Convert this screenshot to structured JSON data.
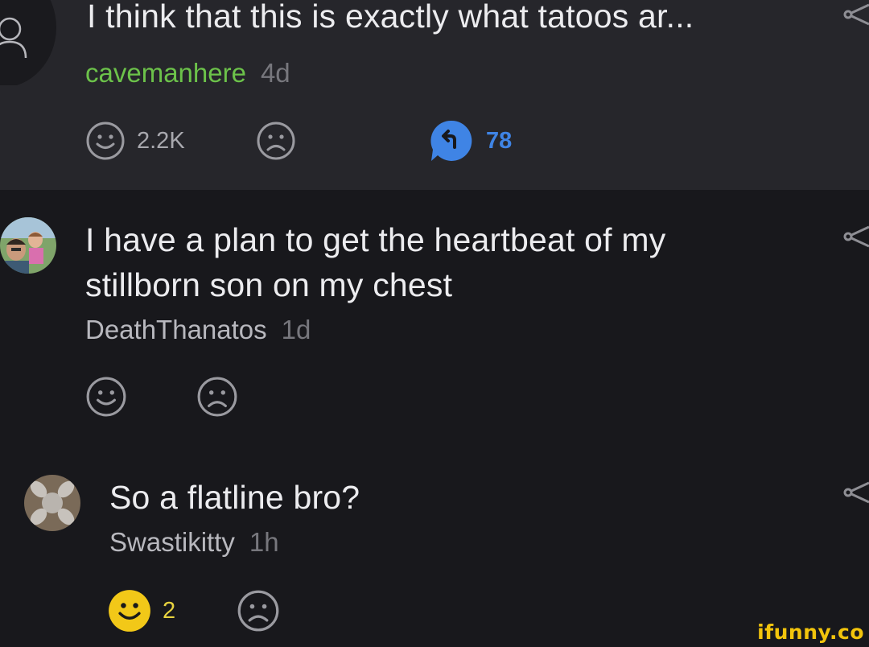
{
  "comments": [
    {
      "text": "I think that this is exactly what tatoos ar...",
      "author": "cavemanhere",
      "time": "4d",
      "like_count": "2.2K",
      "reply_count": "78",
      "avatar_icon": "user-silhouette-icon",
      "colors": {
        "author": "#6cc24a",
        "reply": "#3f84e5",
        "background": "#26262b"
      }
    },
    {
      "text_lines": [
        "I have a plan to get the heartbeat of my",
        "stillborn son on my chest"
      ],
      "author": "DeathThanatos",
      "time": "1d",
      "avatar_icon": "profile-photo"
    },
    {
      "text": "So a flatline bro?",
      "author": "Swastikitty",
      "time": "1h",
      "like_count": "2",
      "avatar_icon": "profile-photo",
      "colors": {
        "like_active": "#f2c818"
      }
    }
  ],
  "icons": [
    "smile-icon",
    "frown-icon",
    "reply-bubble-icon",
    "share-icon"
  ],
  "watermark": "ifunny.co"
}
